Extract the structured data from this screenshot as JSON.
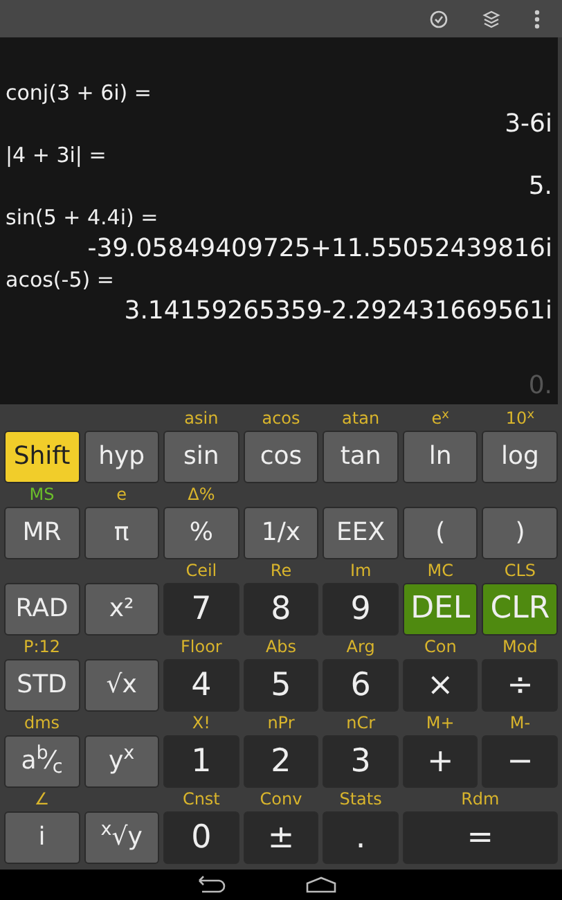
{
  "history": [
    {
      "expression": "conj(3 + 6i) =",
      "result": "3-6i"
    },
    {
      "expression": "|4 + 3i| =",
      "result": "5."
    },
    {
      "expression": "sin(5 + 4.4i) =",
      "result": "-39.05849409725+11.55052439816i"
    },
    {
      "expression": "acos(-5) =",
      "result": "3.14159265359-2.292431669561i"
    }
  ],
  "current": "0.",
  "keypad": [
    [
      {
        "label": "Shift",
        "kind": "shift"
      },
      {
        "label": "hyp",
        "kind": "function"
      },
      {
        "label": "sin",
        "kind": "function",
        "alt": {
          "text": "asin",
          "color": "#d9b52c"
        }
      },
      {
        "label": "cos",
        "kind": "function",
        "alt": {
          "text": "acos",
          "color": "#d9b52c"
        }
      },
      {
        "label": "tan",
        "kind": "function",
        "alt": {
          "text": "atan",
          "color": "#d9b52c"
        }
      },
      {
        "label": "ln",
        "kind": "function",
        "alt": {
          "text": "e$^{x}$",
          "color": "#d9b52c"
        }
      },
      {
        "label": "log",
        "kind": "function",
        "alt": {
          "text": "10$^{x}$",
          "color": "#d9b52c"
        }
      }
    ],
    [
      {
        "label": "MR",
        "kind": "function",
        "alt": {
          "text": "MS",
          "color": "#6cbf2a"
        }
      },
      {
        "label": "π",
        "kind": "function",
        "alt": {
          "text": "e",
          "color": "#d9b52c"
        }
      },
      {
        "label": "%",
        "kind": "function",
        "alt": {
          "text": "Δ%",
          "color": "#d9b52c"
        }
      },
      {
        "label": "1/x",
        "kind": "function"
      },
      {
        "label": "EEX",
        "kind": "function"
      },
      {
        "label": "(",
        "kind": "function"
      },
      {
        "label": ")",
        "kind": "function"
      }
    ],
    [
      {
        "label": "RAD",
        "kind": "function"
      },
      {
        "label": "x²",
        "kind": "function"
      },
      {
        "label": "7",
        "kind": "digit",
        "alt": {
          "text": "Ceil",
          "color": "#d9b52c"
        }
      },
      {
        "label": "8",
        "kind": "digit",
        "alt": {
          "text": "Re",
          "color": "#d9b52c"
        }
      },
      {
        "label": "9",
        "kind": "digit",
        "alt": {
          "text": "Im",
          "color": "#d9b52c"
        }
      },
      {
        "label": "DEL",
        "kind": "clear",
        "alt": {
          "text": "MC",
          "color": "#d9b52c"
        }
      },
      {
        "label": "CLR",
        "kind": "clear",
        "alt": {
          "text": "CLS",
          "color": "#d9b52c"
        }
      }
    ],
    [
      {
        "label": "STD",
        "kind": "function",
        "alt": {
          "text": "P:12",
          "color": "#d9b52c"
        }
      },
      {
        "label": "√x",
        "kind": "function"
      },
      {
        "label": "4",
        "kind": "digit",
        "alt": {
          "text": "Floor",
          "color": "#d9b52c"
        }
      },
      {
        "label": "5",
        "kind": "digit",
        "alt": {
          "text": "Abs",
          "color": "#d9b52c"
        }
      },
      {
        "label": "6",
        "kind": "digit",
        "alt": {
          "text": "Arg",
          "color": "#d9b52c"
        }
      },
      {
        "label": "×",
        "kind": "digit",
        "alt": {
          "text": "Con",
          "color": "#d9b52c"
        }
      },
      {
        "label": "÷",
        "kind": "digit",
        "alt": {
          "text": "Mod",
          "color": "#d9b52c"
        }
      }
    ],
    [
      {
        "label": "a$^{b}$⁄$_{c}$",
        "kind": "function",
        "alt": {
          "text": "dms",
          "color": "#d9b52c"
        }
      },
      {
        "label": "y$^{x}$",
        "kind": "function"
      },
      {
        "label": "1",
        "kind": "digit",
        "alt": {
          "text": "X!",
          "color": "#d9b52c"
        }
      },
      {
        "label": "2",
        "kind": "digit",
        "alt": {
          "text": "nPr",
          "color": "#d9b52c"
        }
      },
      {
        "label": "3",
        "kind": "digit",
        "alt": {
          "text": "nCr",
          "color": "#d9b52c"
        }
      },
      {
        "label": "+",
        "kind": "digit",
        "alt": {
          "text": "M+",
          "color": "#d9b52c"
        }
      },
      {
        "label": "−",
        "kind": "digit",
        "alt": {
          "text": "M-",
          "color": "#d9b52c"
        }
      }
    ],
    [
      {
        "label": "i",
        "kind": "function",
        "alt": {
          "text": "∠",
          "color": "#d9b52c"
        }
      },
      {
        "label": "$^{x}$√y",
        "kind": "function"
      },
      {
        "label": "0",
        "kind": "digit",
        "alt": {
          "text": "Cnst",
          "color": "#d9b52c"
        }
      },
      {
        "label": "±",
        "kind": "digit",
        "alt": {
          "text": "Conv",
          "color": "#d9b52c"
        }
      },
      {
        "label": ".",
        "kind": "digit",
        "alt": {
          "text": "Stats",
          "color": "#d9b52c"
        }
      },
      {
        "label": "=",
        "kind": "digit",
        "wide": true,
        "alt": {
          "text": "Rdm",
          "color": "#d9b52c"
        }
      }
    ]
  ]
}
